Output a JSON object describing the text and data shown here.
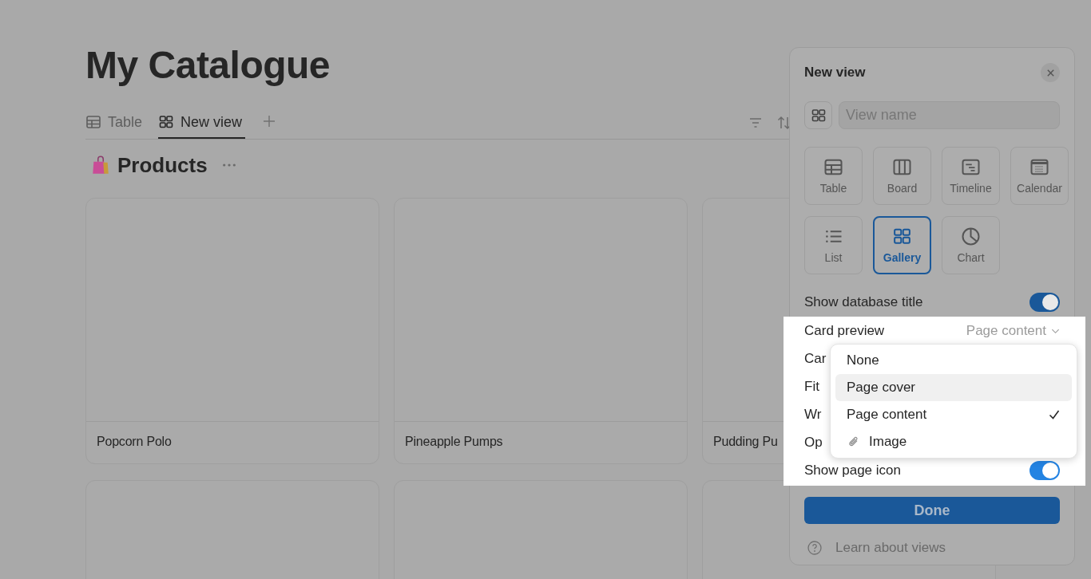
{
  "page": {
    "title": "My Catalogue",
    "tabs": [
      {
        "label": "Table",
        "kind": "table",
        "selected": false
      },
      {
        "label": "New view",
        "kind": "gallery",
        "selected": true
      }
    ],
    "database": {
      "title": "Products"
    },
    "cards": [
      {
        "kind": "titled",
        "title": "Popcorn Polo"
      },
      {
        "kind": "titled",
        "title": "Pineapple Pumps"
      },
      {
        "kind": "titled",
        "title": "Pudding Pu"
      },
      {
        "kind": "cut_off"
      },
      {
        "kind": "cut_off"
      },
      {
        "kind": "cut_off"
      }
    ]
  },
  "panel": {
    "title": "New view",
    "name_field": {
      "placeholder": "View name"
    },
    "view_types": [
      {
        "label": "Table",
        "kind": "table",
        "selected": false
      },
      {
        "label": "Board",
        "kind": "board",
        "selected": false
      },
      {
        "label": "Timeline",
        "kind": "timeline",
        "selected": false
      },
      {
        "label": "Calendar",
        "kind": "calendar",
        "selected": false
      },
      {
        "label": "List",
        "kind": "list",
        "selected": false
      },
      {
        "label": "Gallery",
        "kind": "gallery",
        "selected": true
      },
      {
        "label": "Chart",
        "kind": "chart",
        "selected": false
      }
    ],
    "settings": [
      {
        "label": "Show database title",
        "kind": "toggle",
        "on": true,
        "highlighted": false
      },
      {
        "label": "Card preview",
        "kind": "select",
        "value": "Page content",
        "highlighted": true
      },
      {
        "label": "Car",
        "kind": "label",
        "highlighted": true
      },
      {
        "label": "Fit",
        "kind": "label",
        "highlighted": true
      },
      {
        "label": "Wr",
        "kind": "label",
        "highlighted": true
      },
      {
        "label": "Op",
        "kind": "label",
        "highlighted": true
      },
      {
        "label": "Show page icon",
        "kind": "toggle",
        "on": true,
        "highlighted": true
      }
    ],
    "dropdown": [
      {
        "label": "None",
        "kind": "plain",
        "hovered": false,
        "checked": false
      },
      {
        "label": "Page cover",
        "kind": "plain",
        "hovered": true,
        "checked": false
      },
      {
        "label": "Page content",
        "kind": "plain",
        "hovered": false,
        "checked": true
      },
      {
        "label": "Image",
        "kind": "attachment",
        "hovered": false,
        "checked": false
      }
    ],
    "done_button": "Done",
    "help_link": "Learn about views"
  }
}
